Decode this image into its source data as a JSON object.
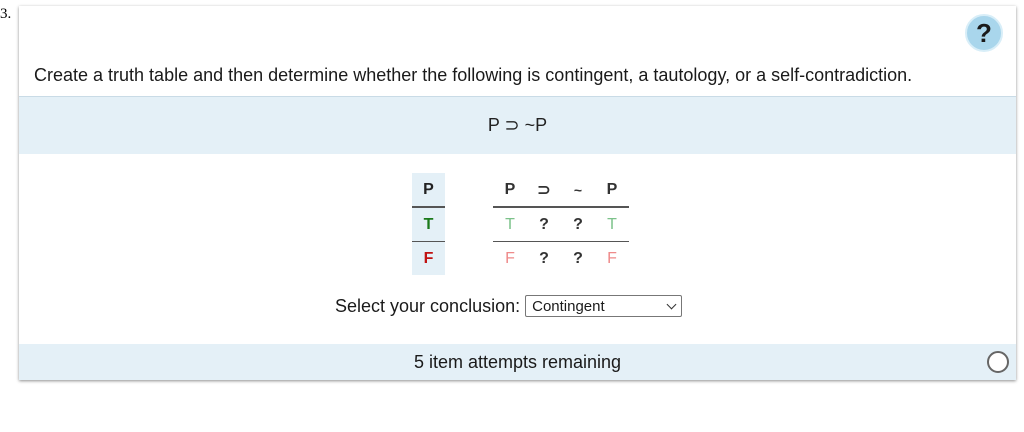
{
  "question_number": "3.",
  "help_label": "?",
  "prompt": "Create a truth table and then determine whether the following is contingent, a tautology, or a self-contradiction.",
  "formula": "P ⊃ ~P",
  "truth_table": {
    "var_header": "P",
    "formula_headers": [
      "P",
      "⊃",
      "~",
      "P"
    ],
    "rows": [
      {
        "var": "T",
        "cells": [
          "T",
          "?",
          "?",
          "T"
        ]
      },
      {
        "var": "F",
        "cells": [
          "F",
          "?",
          "?",
          "F"
        ]
      }
    ]
  },
  "conclusion": {
    "label": "Select your conclusion:",
    "selected": "Contingent"
  },
  "attempts": "5 item attempts remaining",
  "colors": {
    "band": "#e4f0f7",
    "true_strong": "#1b7a1b",
    "false_strong": "#c01212",
    "true_light": "#7cc28a",
    "false_light": "#ee8a8a"
  }
}
